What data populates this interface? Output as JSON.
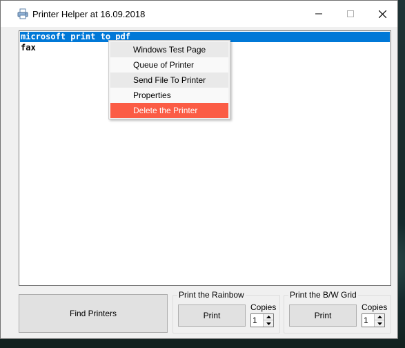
{
  "window": {
    "title": "Printer Helper at 16.09.2018",
    "icon": "printer-icon",
    "controls": [
      "minimize-icon",
      "maximize-icon",
      "close-icon"
    ]
  },
  "printers": {
    "items": [
      "microsoft print to pdf",
      "fax"
    ],
    "selected_index": 0
  },
  "context_menu": {
    "items": [
      "Windows Test Page",
      "Queue of Printer",
      "Send File To Printer",
      "Properties",
      "Delete the Printer"
    ],
    "highlighted_index": 4
  },
  "buttons": {
    "find_printers": "Find Printers"
  },
  "rainbow_group": {
    "legend": "Print the Rainbow",
    "print_label": "Print",
    "copies_label": "Copies",
    "copies_value": "1"
  },
  "grid_group": {
    "legend": "Print the B/W Grid",
    "print_label": "Print",
    "copies_label": "Copies",
    "copies_value": "1"
  },
  "colors": {
    "selection": "#0078d7",
    "danger_highlight": "#fb5c45",
    "window_bg": "#f0f0f0",
    "button_bg": "#e1e1e1"
  }
}
